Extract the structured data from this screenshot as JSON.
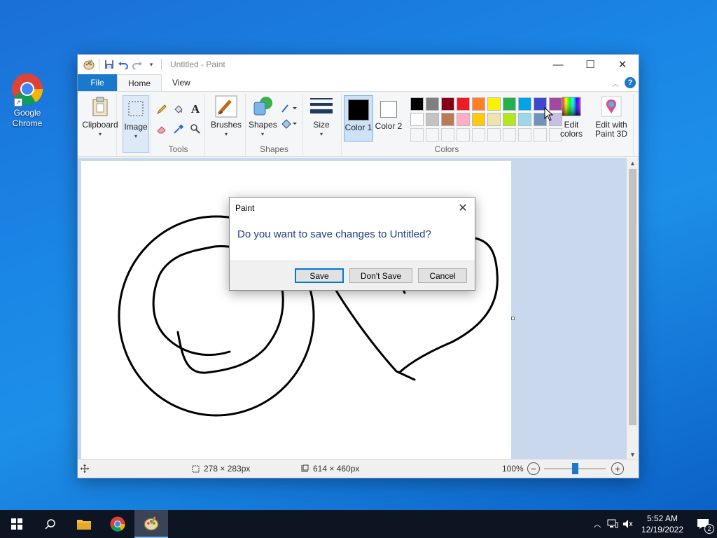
{
  "desktop": {
    "icon_label": "Google Chrome"
  },
  "window": {
    "title": "Untitled - Paint",
    "tabs": [
      "File",
      "Home",
      "View"
    ]
  },
  "ribbon": {
    "clipboard": "Clipboard",
    "image": "Image",
    "tools_group": "Tools",
    "brushes": "Brushes",
    "shapes": "Shapes",
    "shapes_group": "Shapes",
    "size": "Size",
    "color1": "Color 1",
    "color2": "Color 2",
    "colors_group": "Colors",
    "edit_colors": "Edit colors",
    "edit_paint3d": "Edit with Paint 3D",
    "color1_value": "#000000",
    "color2_value": "#ffffff",
    "palette_row1": [
      "#000000",
      "#7f7f7f",
      "#880015",
      "#ed1c24",
      "#ff7f27",
      "#fff200",
      "#22b14c",
      "#00a2e8",
      "#3f48cc",
      "#a349a4"
    ],
    "palette_row2": [
      "#ffffff",
      "#c3c3c3",
      "#b97a57",
      "#ffaec9",
      "#ffc90e",
      "#efe4b0",
      "#b5e61d",
      "#99d9ea",
      "#7092be",
      "#c8bfe7"
    ]
  },
  "status": {
    "selection": "278 × 283px",
    "canvas_size": "614 × 460px",
    "zoom": "100%",
    "zoom_fraction": 0.5
  },
  "dialog": {
    "title": "Paint",
    "message": "Do you want to save changes to Untitled?",
    "save": "Save",
    "dont_save": "Don't Save",
    "cancel": "Cancel"
  },
  "taskbar": {
    "time": "5:52 AM",
    "date": "12/19/2022",
    "notifications": "2"
  }
}
